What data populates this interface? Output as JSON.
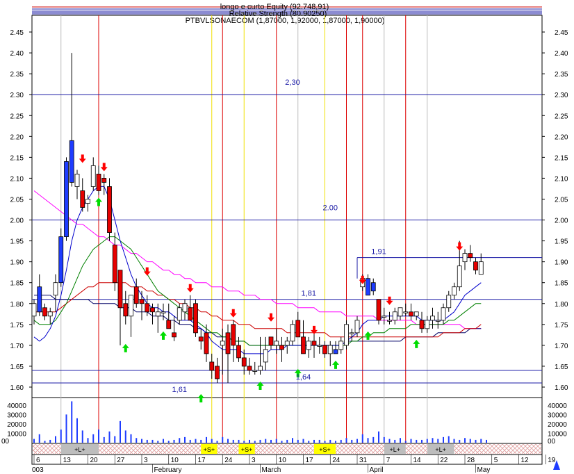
{
  "header": {
    "line1": "longo e curto Equity (92.748,91)",
    "line2": "Relative Strength (80.90250)",
    "line3": "PTBVLSONAECOM (1,87000, 1,92000, 1,87000, 1,90000)"
  },
  "chart_data": {
    "type": "candlestick",
    "y_axis": {
      "min": 1.575,
      "max": 2.49,
      "ticks": [
        1.6,
        1.65,
        1.7,
        1.75,
        1.8,
        1.85,
        1.9,
        1.95,
        2.0,
        2.05,
        2.1,
        2.15,
        2.2,
        2.25,
        2.3,
        2.35,
        2.4,
        2.45
      ]
    },
    "volume_axis": {
      "ticks": [
        "40000",
        "30000",
        "20000",
        "10000",
        "00"
      ]
    },
    "date_ticks": [
      "6",
      "13",
      "20",
      "27",
      "3",
      "10",
      "17",
      "24",
      "3",
      "10",
      "17",
      "24",
      "31",
      "7",
      "14",
      "22",
      "28",
      "5",
      "12",
      "19"
    ],
    "month_labels": [
      {
        "label": "003",
        "index": 0
      },
      {
        "label": "February",
        "index": 22
      },
      {
        "label": "March",
        "index": 42
      },
      {
        "label": "April",
        "index": 62
      },
      {
        "label": "May",
        "index": 82
      }
    ],
    "level_labels": [
      {
        "text": "2,30",
        "value": 2.33,
        "index": 48
      },
      {
        "text": "2.00",
        "value": 2.03,
        "index": 55
      },
      {
        "text": "1,91",
        "value": 1.925,
        "index": 64
      },
      {
        "text": "1,81",
        "value": 1.825,
        "index": 51
      },
      {
        "text": "1,64",
        "value": 1.625,
        "index": 50
      },
      {
        "text": "1,61",
        "value": 1.595,
        "index": 27
      }
    ],
    "horizontal_levels": [
      2.3,
      2.0,
      1.81,
      1.64,
      1.61
    ],
    "partial_level": {
      "value": 1.91,
      "from_index": 60
    },
    "red_vlines": [
      12,
      35,
      45,
      58,
      61,
      69
    ],
    "yellow_vlines": [
      33,
      39,
      54
    ],
    "gray_vlines": [
      5,
      49,
      65,
      73
    ],
    "bands": [
      {
        "label": "+L+",
        "from": 5,
        "to": 12
      },
      {
        "label": "+S+",
        "from": 31,
        "to": 34
      },
      {
        "label": "+S+",
        "from": 38,
        "to": 41
      },
      {
        "label": "+S+",
        "from": 52,
        "to": 56
      },
      {
        "label": "+L+",
        "from": 65,
        "to": 69
      },
      {
        "label": "+L+",
        "from": 73,
        "to": 78
      }
    ],
    "candles": [
      {
        "o": 1.77,
        "h": 1.81,
        "l": 1.75,
        "c": 1.8
      },
      {
        "o": 1.78,
        "h": 1.87,
        "l": 1.77,
        "c": 1.84
      },
      {
        "o": 1.79,
        "h": 1.8,
        "l": 1.76,
        "c": 1.77
      },
      {
        "o": 1.77,
        "h": 1.79,
        "l": 1.75,
        "c": 1.78
      },
      {
        "o": 1.82,
        "h": 1.87,
        "l": 1.78,
        "c": 1.85
      },
      {
        "o": 1.85,
        "h": 1.98,
        "l": 1.84,
        "c": 1.96
      },
      {
        "o": 1.96,
        "h": 2.15,
        "l": 1.95,
        "c": 2.14
      },
      {
        "o": 2.09,
        "h": 2.4,
        "l": 2.08,
        "c": 2.19
      },
      {
        "o": 2.08,
        "h": 2.12,
        "l": 2.05,
        "c": 2.11
      },
      {
        "o": 2.07,
        "h": 2.1,
        "l": 2.02,
        "c": 2.03
      },
      {
        "o": 2.04,
        "h": 2.06,
        "l": 2.02,
        "c": 2.05
      },
      {
        "o": 2.08,
        "h": 2.15,
        "l": 2.07,
        "c": 2.13
      },
      {
        "o": 2.11,
        "h": 2.13,
        "l": 2.06,
        "c": 2.07
      },
      {
        "o": 2.1,
        "h": 2.11,
        "l": 2.06,
        "c": 2.09
      },
      {
        "o": 2.08,
        "h": 2.1,
        "l": 1.95,
        "c": 1.97
      },
      {
        "o": 1.94,
        "h": 1.97,
        "l": 1.83,
        "c": 1.85
      },
      {
        "o": 1.88,
        "h": 1.88,
        "l": 1.7,
        "c": 1.79
      },
      {
        "o": 1.8,
        "h": 1.83,
        "l": 1.75,
        "c": 1.77
      },
      {
        "o": 1.77,
        "h": 1.79,
        "l": 1.72,
        "c": 1.82
      },
      {
        "o": 1.84,
        "h": 1.86,
        "l": 1.79,
        "c": 1.8
      },
      {
        "o": 1.81,
        "h": 1.83,
        "l": 1.76,
        "c": 1.8
      },
      {
        "o": 1.8,
        "h": 1.82,
        "l": 1.77,
        "c": 1.78
      },
      {
        "o": 1.79,
        "h": 1.8,
        "l": 1.75,
        "c": 1.78
      },
      {
        "o": 1.77,
        "h": 1.8,
        "l": 1.73,
        "c": 1.78
      },
      {
        "o": 1.78,
        "h": 1.8,
        "l": 1.76,
        "c": 1.78
      },
      {
        "o": 1.76,
        "h": 1.8,
        "l": 1.74,
        "c": 1.74
      },
      {
        "o": 1.73,
        "h": 1.77,
        "l": 1.71,
        "c": 1.72
      },
      {
        "o": 1.76,
        "h": 1.8,
        "l": 1.75,
        "c": 1.79
      },
      {
        "o": 1.78,
        "h": 1.81,
        "l": 1.76,
        "c": 1.8
      },
      {
        "o": 1.79,
        "h": 1.82,
        "l": 1.76,
        "c": 1.76
      },
      {
        "o": 1.8,
        "h": 1.81,
        "l": 1.72,
        "c": 1.73
      },
      {
        "o": 1.72,
        "h": 1.74,
        "l": 1.69,
        "c": 1.71
      },
      {
        "o": 1.73,
        "h": 1.75,
        "l": 1.66,
        "c": 1.68
      },
      {
        "o": 1.66,
        "h": 1.68,
        "l": 1.62,
        "c": 1.64
      },
      {
        "o": 1.65,
        "h": 1.67,
        "l": 1.61,
        "c": 1.62
      },
      {
        "o": 1.7,
        "h": 1.74,
        "l": 1.63,
        "c": 1.71
      },
      {
        "o": 1.73,
        "h": 1.75,
        "l": 1.61,
        "c": 1.68
      },
      {
        "o": 1.75,
        "h": 1.76,
        "l": 1.66,
        "c": 1.7
      },
      {
        "o": 1.7,
        "h": 1.72,
        "l": 1.66,
        "c": 1.67
      },
      {
        "o": 1.67,
        "h": 1.69,
        "l": 1.63,
        "c": 1.65
      },
      {
        "o": 1.65,
        "h": 1.67,
        "l": 1.63,
        "c": 1.64
      },
      {
        "o": 1.64,
        "h": 1.66,
        "l": 1.63,
        "c": 1.64
      },
      {
        "o": 1.64,
        "h": 1.72,
        "l": 1.63,
        "c": 1.65
      },
      {
        "o": 1.66,
        "h": 1.72,
        "l": 1.64,
        "c": 1.69
      },
      {
        "o": 1.72,
        "h": 1.72,
        "l": 1.69,
        "c": 1.7
      },
      {
        "o": 1.7,
        "h": 1.74,
        "l": 1.68,
        "c": 1.71
      },
      {
        "o": 1.7,
        "h": 1.72,
        "l": 1.66,
        "c": 1.69
      },
      {
        "o": 1.7,
        "h": 1.72,
        "l": 1.68,
        "c": 1.71
      },
      {
        "o": 1.71,
        "h": 1.76,
        "l": 1.7,
        "c": 1.75
      },
      {
        "o": 1.76,
        "h": 1.78,
        "l": 1.72,
        "c": 1.72
      },
      {
        "o": 1.72,
        "h": 1.76,
        "l": 1.68,
        "c": 1.68
      },
      {
        "o": 1.69,
        "h": 1.72,
        "l": 1.67,
        "c": 1.71
      },
      {
        "o": 1.71,
        "h": 1.73,
        "l": 1.67,
        "c": 1.7
      },
      {
        "o": 1.7,
        "h": 1.72,
        "l": 1.68,
        "c": 1.7
      },
      {
        "o": 1.7,
        "h": 1.71,
        "l": 1.67,
        "c": 1.68
      },
      {
        "o": 1.68,
        "h": 1.71,
        "l": 1.65,
        "c": 1.7
      },
      {
        "o": 1.69,
        "h": 1.71,
        "l": 1.68,
        "c": 1.68
      },
      {
        "o": 1.69,
        "h": 1.72,
        "l": 1.68,
        "c": 1.71
      },
      {
        "o": 1.7,
        "h": 1.76,
        "l": 1.69,
        "c": 1.75
      },
      {
        "o": 1.73,
        "h": 1.74,
        "l": 1.71,
        "c": 1.73
      },
      {
        "o": 1.73,
        "h": 1.77,
        "l": 1.72,
        "c": 1.76
      },
      {
        "o": 1.84,
        "h": 1.87,
        "l": 1.83,
        "c": 1.86
      },
      {
        "o": 1.86,
        "h": 1.87,
        "l": 1.82,
        "c": 1.82
      },
      {
        "o": 1.85,
        "h": 1.86,
        "l": 1.82,
        "c": 1.83
      },
      {
        "o": 1.81,
        "h": 1.81,
        "l": 1.75,
        "c": 1.76
      },
      {
        "o": 1.77,
        "h": 1.79,
        "l": 1.75,
        "c": 1.77
      },
      {
        "o": 1.76,
        "h": 1.78,
        "l": 1.75,
        "c": 1.76
      },
      {
        "o": 1.76,
        "h": 1.79,
        "l": 1.75,
        "c": 1.78
      },
      {
        "o": 1.77,
        "h": 1.79,
        "l": 1.76,
        "c": 1.79
      },
      {
        "o": 1.78,
        "h": 1.8,
        "l": 1.77,
        "c": 1.78
      },
      {
        "o": 1.78,
        "h": 1.8,
        "l": 1.76,
        "c": 1.77
      },
      {
        "o": 1.77,
        "h": 1.78,
        "l": 1.76,
        "c": 1.78
      },
      {
        "o": 1.76,
        "h": 1.78,
        "l": 1.73,
        "c": 1.74
      },
      {
        "o": 1.74,
        "h": 1.77,
        "l": 1.73,
        "c": 1.76
      },
      {
        "o": 1.76,
        "h": 1.79,
        "l": 1.74,
        "c": 1.77
      },
      {
        "o": 1.76,
        "h": 1.78,
        "l": 1.74,
        "c": 1.76
      },
      {
        "o": 1.76,
        "h": 1.8,
        "l": 1.75,
        "c": 1.79
      },
      {
        "o": 1.79,
        "h": 1.83,
        "l": 1.78,
        "c": 1.82
      },
      {
        "o": 1.82,
        "h": 1.85,
        "l": 1.81,
        "c": 1.84
      },
      {
        "o": 1.84,
        "h": 1.95,
        "l": 1.83,
        "c": 1.89
      },
      {
        "o": 1.9,
        "h": 1.93,
        "l": 1.88,
        "c": 1.92
      },
      {
        "o": 1.92,
        "h": 1.94,
        "l": 1.9,
        "c": 1.91
      },
      {
        "o": 1.9,
        "h": 1.91,
        "l": 1.87,
        "c": 1.88
      },
      {
        "o": 1.87,
        "h": 1.92,
        "l": 1.87,
        "c": 1.9
      }
    ],
    "volume": [
      4000,
      9000,
      2000,
      3000,
      7000,
      14000,
      30000,
      44000,
      26000,
      13000,
      5000,
      9000,
      14000,
      6000,
      12000,
      7000,
      23000,
      13000,
      9000,
      5000,
      4000,
      3000,
      3000,
      2000,
      4000,
      2000,
      3000,
      5000,
      6000,
      3000,
      4000,
      3000,
      6000,
      4000,
      2000,
      6000,
      4000,
      3000,
      3000,
      2000,
      3000,
      2000,
      3000,
      4000,
      3000,
      4000,
      2000,
      3000,
      5000,
      3000,
      4000,
      2000,
      3000,
      3000,
      2000,
      3000,
      2000,
      3000,
      5000,
      3000,
      4000,
      9000,
      5000,
      6000,
      12000,
      6000,
      4000,
      3000,
      5000,
      2000,
      4000,
      3000,
      3000,
      4000,
      5000,
      4000,
      6000,
      7000,
      4000,
      3000,
      5000,
      4000,
      3000,
      4000,
      3000
    ],
    "arrows_down": [
      {
        "index": 9,
        "value": 2.14
      },
      {
        "index": 13,
        "value": 2.12
      },
      {
        "index": 21,
        "value": 1.87
      },
      {
        "index": 29,
        "value": 1.83
      },
      {
        "index": 37,
        "value": 1.77
      },
      {
        "index": 44,
        "value": 1.76
      },
      {
        "index": 52,
        "value": 1.73
      },
      {
        "index": 61,
        "value": 1.85
      },
      {
        "index": 66,
        "value": 1.8
      },
      {
        "index": 79,
        "value": 1.93
      }
    ],
    "arrows_up": [
      {
        "index": 12,
        "value": 2.05
      },
      {
        "index": 17,
        "value": 1.7
      },
      {
        "index": 24,
        "value": 1.73
      },
      {
        "index": 31,
        "value": 1.58
      },
      {
        "index": 42,
        "value": 1.61
      },
      {
        "index": 49,
        "value": 1.64
      },
      {
        "index": 56,
        "value": 1.66
      },
      {
        "index": 62,
        "value": 1.73
      },
      {
        "index": 71,
        "value": 1.71
      }
    ],
    "ma_fast": [
      1.72,
      1.71,
      1.72,
      1.74,
      1.77,
      1.82,
      1.88,
      1.95,
      2.0,
      2.03,
      2.05,
      2.07,
      2.08,
      2.08,
      2.05,
      2.0,
      1.95,
      1.91,
      1.87,
      1.84,
      1.82,
      1.8,
      1.79,
      1.79,
      1.78,
      1.78,
      1.77,
      1.76,
      1.76,
      1.76,
      1.75,
      1.74,
      1.73,
      1.71,
      1.7,
      1.69,
      1.69,
      1.69,
      1.69,
      1.68,
      1.68,
      1.68,
      1.68,
      1.68,
      1.69,
      1.69,
      1.69,
      1.7,
      1.7,
      1.7,
      1.7,
      1.7,
      1.7,
      1.7,
      1.7,
      1.7,
      1.7,
      1.7,
      1.71,
      1.72,
      1.73,
      1.75,
      1.76,
      1.76,
      1.76,
      1.77,
      1.77,
      1.77,
      1.77,
      1.77,
      1.77,
      1.77,
      1.76,
      1.76,
      1.76,
      1.76,
      1.76,
      1.77,
      1.78,
      1.8,
      1.82,
      1.83,
      1.84,
      1.85
    ],
    "ma_mid": [
      1.76,
      1.75,
      1.75,
      1.75,
      1.76,
      1.78,
      1.8,
      1.83,
      1.86,
      1.89,
      1.91,
      1.93,
      1.94,
      1.95,
      1.96,
      1.96,
      1.95,
      1.94,
      1.93,
      1.91,
      1.89,
      1.87,
      1.85,
      1.83,
      1.82,
      1.81,
      1.8,
      1.79,
      1.78,
      1.77,
      1.76,
      1.75,
      1.74,
      1.73,
      1.73,
      1.72,
      1.72,
      1.71,
      1.71,
      1.71,
      1.7,
      1.7,
      1.7,
      1.7,
      1.7,
      1.7,
      1.7,
      1.7,
      1.7,
      1.7,
      1.7,
      1.7,
      1.7,
      1.7,
      1.7,
      1.7,
      1.7,
      1.7,
      1.7,
      1.71,
      1.71,
      1.72,
      1.72,
      1.73,
      1.73,
      1.73,
      1.74,
      1.74,
      1.74,
      1.74,
      1.75,
      1.75,
      1.75,
      1.75,
      1.75,
      1.75,
      1.75,
      1.76,
      1.76,
      1.77,
      1.78,
      1.79,
      1.8,
      1.8
    ],
    "ma_slow_red": [
      1.78,
      1.78,
      1.78,
      1.78,
      1.78,
      1.79,
      1.8,
      1.81,
      1.82,
      1.83,
      1.84,
      1.84,
      1.85,
      1.85,
      1.85,
      1.85,
      1.85,
      1.85,
      1.84,
      1.84,
      1.84,
      1.83,
      1.83,
      1.82,
      1.82,
      1.81,
      1.81,
      1.8,
      1.8,
      1.79,
      1.79,
      1.78,
      1.78,
      1.77,
      1.77,
      1.76,
      1.76,
      1.76,
      1.75,
      1.75,
      1.75,
      1.74,
      1.74,
      1.74,
      1.74,
      1.74,
      1.74,
      1.73,
      1.73,
      1.73,
      1.73,
      1.73,
      1.73,
      1.73,
      1.73,
      1.72,
      1.72,
      1.72,
      1.72,
      1.72,
      1.72,
      1.72,
      1.72,
      1.72,
      1.72,
      1.72,
      1.72,
      1.72,
      1.72,
      1.72,
      1.72,
      1.72,
      1.72,
      1.72,
      1.72,
      1.72,
      1.73,
      1.73,
      1.73,
      1.73,
      1.74,
      1.74,
      1.74,
      1.75
    ],
    "ma_pink": [
      2.07,
      2.06,
      2.05,
      2.04,
      2.03,
      2.02,
      2.01,
      2.0,
      1.99,
      1.99,
      1.98,
      1.97,
      1.96,
      1.96,
      1.95,
      1.94,
      1.94,
      1.93,
      1.92,
      1.92,
      1.91,
      1.9,
      1.9,
      1.89,
      1.88,
      1.88,
      1.87,
      1.87,
      1.86,
      1.86,
      1.85,
      1.85,
      1.85,
      1.84,
      1.84,
      1.84,
      1.83,
      1.83,
      1.83,
      1.82,
      1.82,
      1.82,
      1.81,
      1.81,
      1.81,
      1.8,
      1.8,
      1.8,
      1.8,
      1.79,
      1.79,
      1.79,
      1.79,
      1.78,
      1.78,
      1.78,
      1.78,
      1.78,
      1.77,
      1.77,
      1.77,
      1.77,
      1.77,
      1.77,
      1.76,
      1.76,
      1.76,
      1.76,
      1.76,
      1.76,
      1.76,
      1.75,
      1.75,
      1.75,
      1.75,
      1.75,
      1.75,
      1.75,
      1.75,
      1.75,
      1.74,
      1.74,
      1.74,
      1.74
    ],
    "ma_navy": [
      1.82,
      1.82,
      1.82,
      1.82,
      1.81,
      1.81,
      1.81,
      1.81,
      1.81,
      1.81,
      1.81,
      1.8,
      1.8,
      1.8,
      1.8,
      1.8,
      1.79,
      1.79,
      1.79,
      1.78,
      1.78,
      1.78,
      1.77,
      1.77,
      1.77,
      1.76,
      1.76,
      1.75,
      1.75,
      1.75,
      1.74,
      1.74,
      1.73,
      1.73,
      1.72,
      1.72,
      1.72,
      1.71,
      1.71,
      1.71,
      1.7,
      1.7,
      1.7,
      1.7,
      1.7,
      1.7,
      1.7,
      1.7,
      1.7,
      1.7,
      1.7,
      1.7,
      1.7,
      1.7,
      1.7,
      1.7,
      1.7,
      1.7,
      1.71,
      1.71,
      1.71,
      1.71,
      1.71,
      1.71,
      1.71,
      1.71,
      1.71,
      1.71,
      1.71,
      1.72,
      1.72,
      1.72,
      1.72,
      1.72,
      1.72,
      1.73,
      1.73,
      1.73,
      1.73,
      1.73,
      1.73,
      1.74,
      1.74,
      1.74
    ],
    "colors": {
      "bull_body": "#ffffff",
      "bear_body": "#e60000",
      "up_blue": "#1e3cff",
      "ma_fast": "#0000cc",
      "ma_mid": "#008000",
      "ma_slow": "#cc0000",
      "ma_pink": "#ff00ff",
      "ma_navy": "#000066",
      "level": "#1a1aa6",
      "red_vline": "#dd0000",
      "yellow_vline": "#f0e000",
      "gray_vline": "#bbbbbb",
      "arrow_down": "#ff0000",
      "arrow_up": "#00dd00",
      "band_yellow": "#ffff00",
      "band_gray": "#bdbdbd",
      "band_hatch": "#e0a0a0"
    }
  }
}
